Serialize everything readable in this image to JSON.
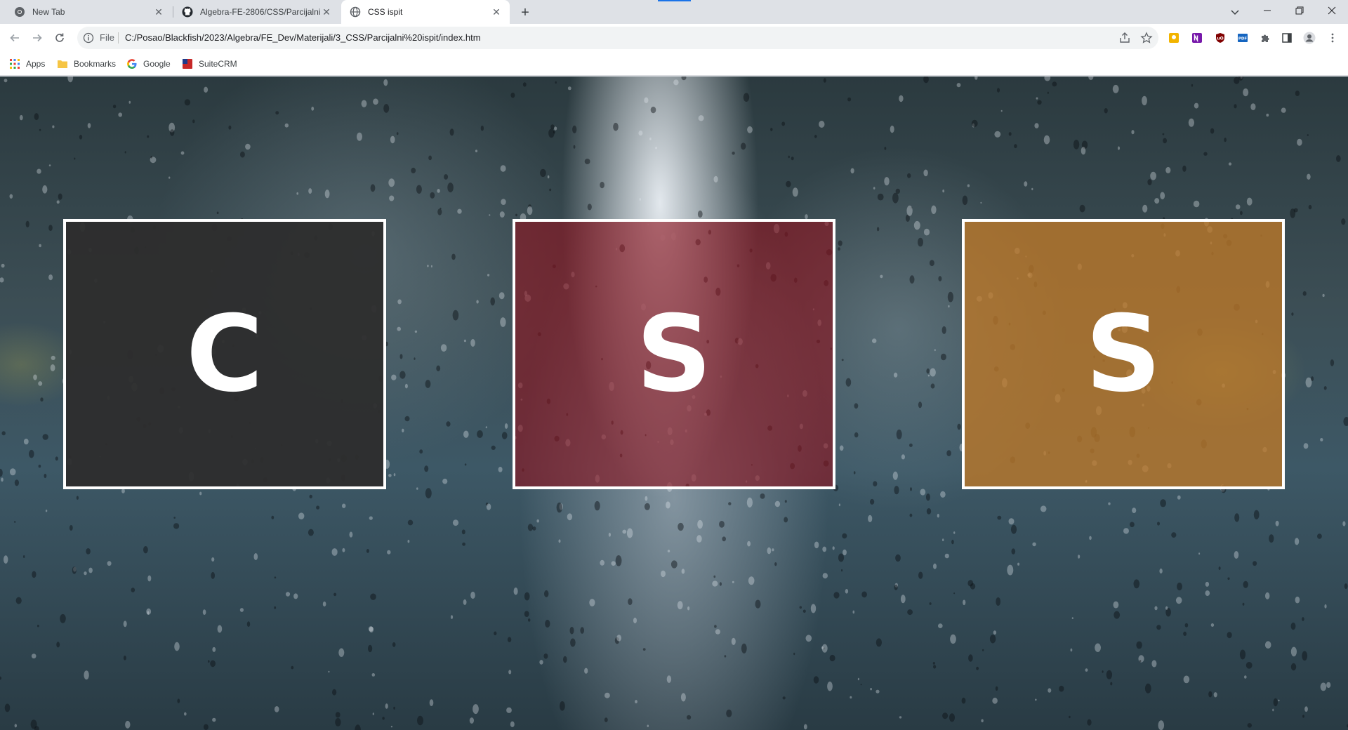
{
  "tabs": [
    {
      "title": "New Tab",
      "icon": "chrome-icon",
      "active": false
    },
    {
      "title": "Algebra-FE-2806/CSS/Parcijalni",
      "icon": "github-icon",
      "active": false
    },
    {
      "title": "CSS ispit",
      "icon": "globe-icon",
      "active": true
    }
  ],
  "toolbar": {
    "scheme_label": "File",
    "url": "C:/Posao/Blackfish/2023/Algebra/FE_Dev/Materijali/3_CSS/Parcijalni%20ispit/index.htm"
  },
  "bookmarks": [
    {
      "label": "Apps",
      "icon": "apps-grid-icon"
    },
    {
      "label": "Bookmarks",
      "icon": "folder-icon"
    },
    {
      "label": "Google",
      "icon": "google-icon"
    },
    {
      "label": "SuiteCRM",
      "icon": "suitecrm-icon"
    }
  ],
  "page": {
    "boxes": [
      {
        "letter": "C",
        "color": "#2d2d2d"
      },
      {
        "letter": "S",
        "color": "#8c141e"
      },
      {
        "letter": "S",
        "color": "#be7828"
      }
    ]
  },
  "colors": {
    "tabstrip_bg": "#dee1e6",
    "toolbar_bg": "#ffffff",
    "omnibox_bg": "#f1f3f4",
    "accent": "#1a73e8"
  }
}
